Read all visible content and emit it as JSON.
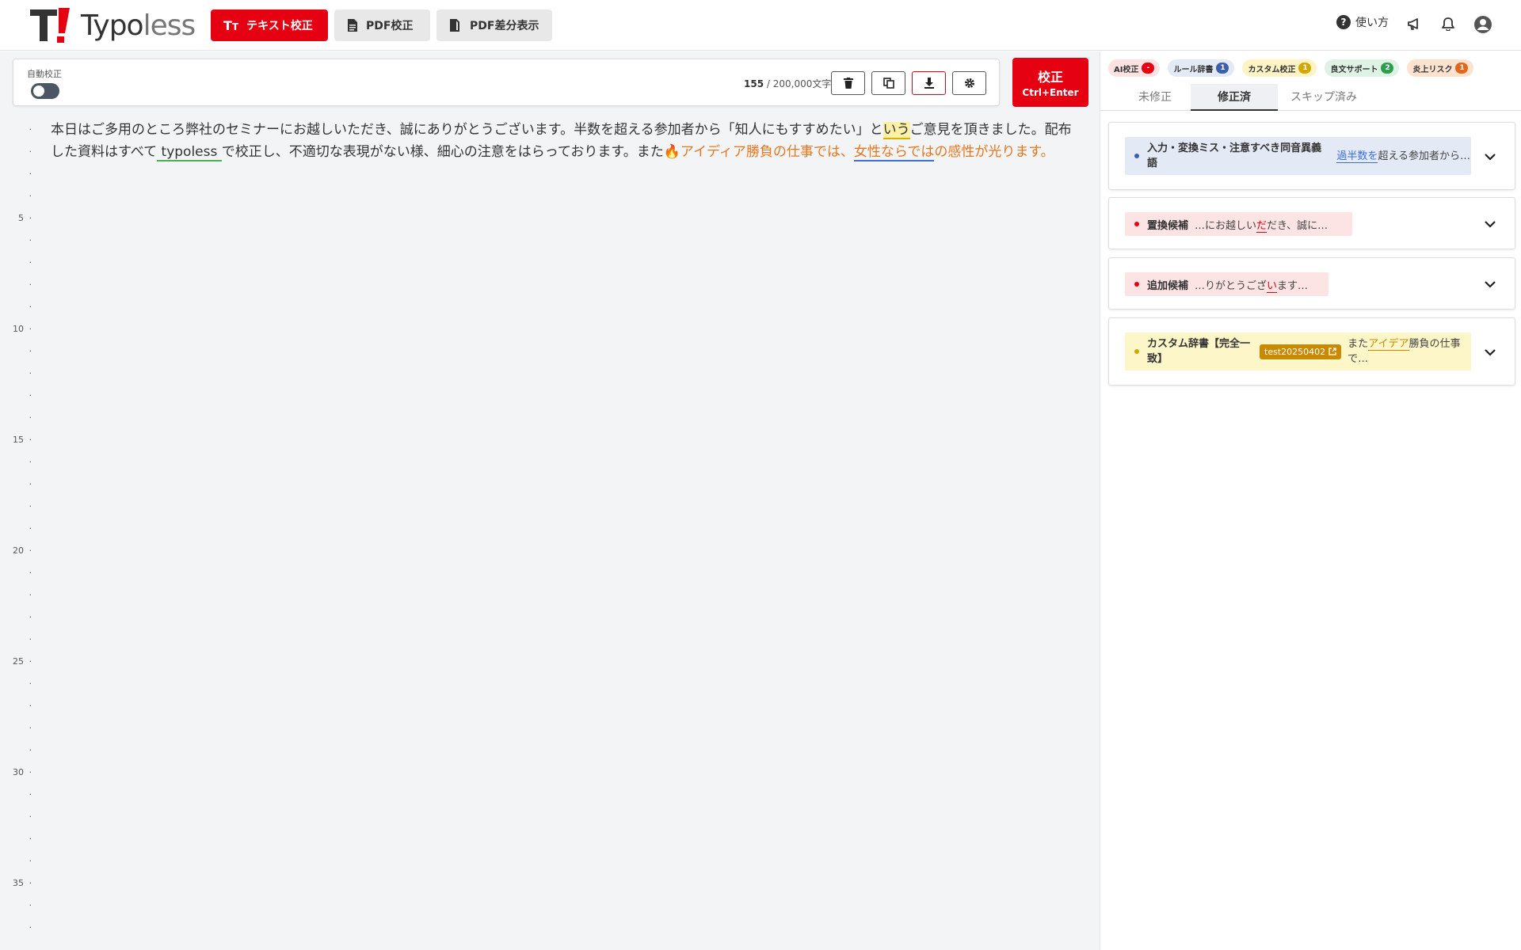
{
  "header": {
    "logo_main": "Typo",
    "logo_sub": "less",
    "nav": [
      {
        "label": "テキスト校正"
      },
      {
        "label": "PDF校正"
      },
      {
        "label": "PDF差分表示"
      }
    ],
    "help_label": "使い方"
  },
  "toolbar": {
    "auto_label": "自動校正",
    "count_current": "155",
    "count_sep": " / ",
    "count_max": "200,000文字",
    "run_label": "校正",
    "run_shortcut": "Ctrl+Enter"
  },
  "gutter": {
    "numbers": [
      "5",
      "10",
      "15",
      "20",
      "25",
      "30",
      "35"
    ]
  },
  "editor": {
    "t1": "本日はご多用のところ弊社のセミナーにお越しいただき、誠にありがとうございます。半数を超える参加者から「知人にもすすめたい」と",
    "t2": "いう",
    "t3": "ご意見を頂きました。配布した資料はすべて",
    "t4": " typoless ",
    "t5": "で校正し、不適切な表現がない様、細心の注意をはらっております。また",
    "t6": "アイディア勝負の仕事では、",
    "t7": "女性ならでは",
    "t8": "の感性が光ります。"
  },
  "panel": {
    "badges": [
      {
        "label": "AI校正",
        "count": "-",
        "bg": "#fde2e2",
        "num_bg": "#e50012"
      },
      {
        "label": "ルール辞書",
        "count": "1",
        "bg": "#e3e9f5",
        "num_bg": "#3b5fa8"
      },
      {
        "label": "カスタム校正",
        "count": "1",
        "bg": "#fdf3c4",
        "num_bg": "#d4a700"
      },
      {
        "label": "良文サポート",
        "count": "2",
        "bg": "#dff3e4",
        "num_bg": "#2e9d4d"
      },
      {
        "label": "炎上リスク",
        "count": "1",
        "bg": "#fde3cf",
        "num_bg": "#e0681b"
      }
    ],
    "tabs": [
      {
        "label": "未修正"
      },
      {
        "label": "修正済"
      },
      {
        "label": "スキップ済み"
      }
    ],
    "cards": [
      {
        "title": "入力・変換ミス・注意すべき同音異義語",
        "snippet_a": "過半数を",
        "snippet_b": "超える参加者から…"
      },
      {
        "title": "置換候補",
        "snippet_a": "…にお越しい",
        "snippet_b": "だ",
        "snippet_c": "だき、誠に…"
      },
      {
        "title": "追加候補",
        "snippet_a": "…りがとうござ",
        "snippet_b": "い",
        "snippet_c": "ます…"
      },
      {
        "title": "カスタム辞書【完全一致】",
        "tag": "test20250402",
        "snippet_a": "また",
        "snippet_b": "アイデア",
        "snippet_c": "勝負の仕事で…"
      }
    ]
  }
}
